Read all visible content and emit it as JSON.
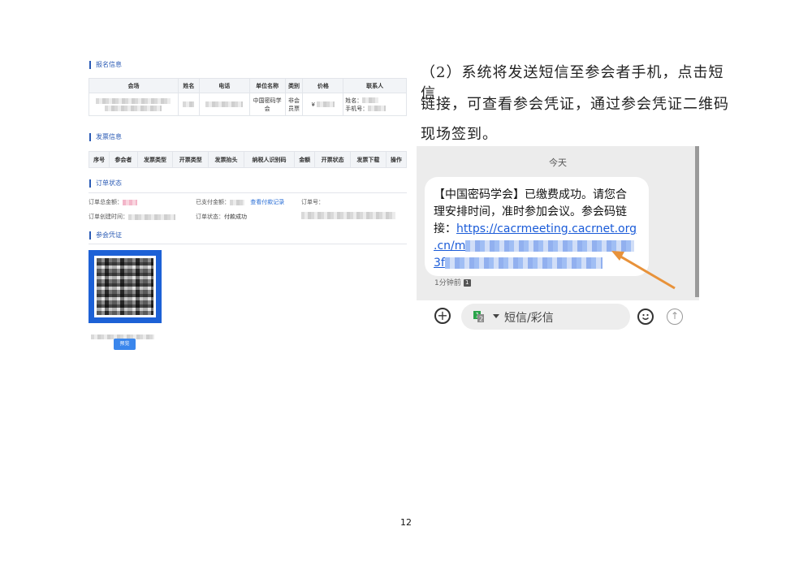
{
  "sections": {
    "registration": "报名信息",
    "invoice": "发票信息",
    "order": "订单状态",
    "credential": "参会凭证"
  },
  "registration_table": {
    "headers": [
      "会场",
      "姓名",
      "电话",
      "单位名称",
      "类别",
      "价格",
      "联系人"
    ],
    "row": {
      "org": "中国密码学会",
      "category": "非会员票",
      "price_prefix": "¥",
      "contact_name_label": "姓名：",
      "contact_phone_label": "手机号："
    }
  },
  "invoice_table": {
    "headers": [
      "序号",
      "参会者",
      "发票类型",
      "开票类型",
      "发票抬头",
      "纳税人识别码",
      "金额",
      "开票状态",
      "发票下载",
      "操作"
    ]
  },
  "order_status": {
    "total_label": "订单总金额：",
    "paid_label": "已支付金额：",
    "paid_link": "查看付款记录",
    "order_no_label": "订单号：",
    "created_label": "订单创建时间：",
    "status_label": "订单状态：",
    "status_value": "付款成功"
  },
  "credential": {
    "preview_button": "预览"
  },
  "paragraph": {
    "line1": "（2）系统将发送短信至参会者手机，点击短信",
    "line2": "链接，可查看参会凭证，通过参会凭证二维码",
    "line3": "现场签到。"
  },
  "sms": {
    "date_header": "今天",
    "line1": "【中国密码学会】已缴费成功。请您合",
    "line2": "理安排时间，准时参加会议。参会码链",
    "line3_prefix": "接：",
    "link_start": "https://cacrmeeting.cacrnet.org",
    "link_line2": ".cn/m",
    "link_line3": "3f",
    "time": "1分钟前",
    "time_badge": "1",
    "input_placeholder": "短信/彩信",
    "sim_badge_1": "1",
    "sim_badge_2": "2",
    "arrow_color": "#e8923a"
  },
  "page_number": "12"
}
